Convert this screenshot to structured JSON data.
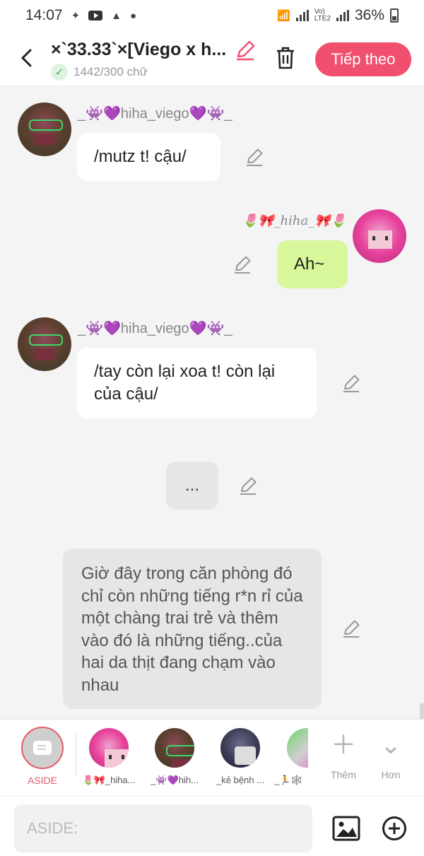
{
  "status_bar": {
    "time": "14:07",
    "battery": "36%",
    "icons": [
      "dot-icon",
      "youtube-icon",
      "mm-icon",
      "dot-icon",
      "wifi-icon",
      "signal-icon",
      "volte-icon",
      "battery-icon"
    ]
  },
  "header": {
    "title": "×`33.33`×[Viego x h...",
    "counter": "1442/300 chữ",
    "next_button": "Tiếp theo"
  },
  "messages": [
    {
      "sender": "_👾💜hiha_viego💜👾_",
      "text": "/mutz t! cậu/",
      "side": "left"
    },
    {
      "sender": "🌷🎀_hiha_🎀🌷",
      "text": "Ah~",
      "side": "right"
    },
    {
      "sender": "_👾💜hiha_viego💜👾_",
      "text": "/tay còn lại xoa t! còn lại của cậu/",
      "side": "left"
    },
    {
      "text": "...",
      "side": "center"
    },
    {
      "text": "Giờ đây trong căn phòng đó chỉ còn những tiếng r*n rỉ của một chàng trai trẻ và thêm vào đó là những tiếng..của hai da thịt đang chạm vào nhau",
      "side": "narration"
    }
  ],
  "character_bar": {
    "aside_label": "ASIDE",
    "characters": [
      {
        "name": "🌷🎀_hiha..."
      },
      {
        "name": "_👾💜hih..."
      },
      {
        "name": "_kẻ bệnh ..."
      },
      {
        "name": "_🏃🕸️"
      }
    ],
    "add_label": "Thêm",
    "more_label": "Hơn"
  },
  "input": {
    "placeholder": "ASIDE:"
  },
  "colors": {
    "accent": "#f04f6e",
    "my_bubble": "#d9f79b",
    "gray_bubble": "#e6e6e6",
    "background": "#f4f4f4"
  }
}
